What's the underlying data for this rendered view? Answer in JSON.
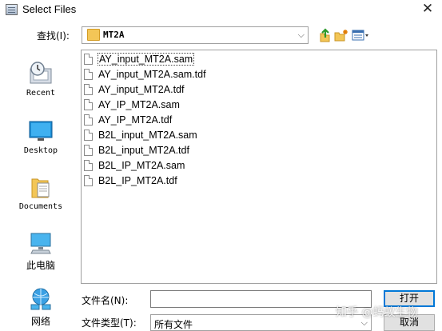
{
  "window": {
    "title": "Select Files",
    "close_glyph": "✕"
  },
  "toolbar": {
    "look_in_label": "查找(I):",
    "look_in_value": "MT2A",
    "dropdown_glyph": "⌵"
  },
  "places": [
    {
      "label": "Recent",
      "icon": "recent-icon"
    },
    {
      "label": "Desktop",
      "icon": "desktop-icon"
    },
    {
      "label": "Documents",
      "icon": "documents-icon"
    },
    {
      "label": "此电脑",
      "icon": "computer-icon"
    },
    {
      "label": "网络",
      "icon": "network-icon"
    }
  ],
  "files": [
    "AY_input_MT2A.sam",
    "AY_input_MT2A.sam.tdf",
    "AY_input_MT2A.tdf",
    "AY_IP_MT2A.sam",
    "AY_IP_MT2A.tdf",
    "B2L_input_MT2A.sam",
    "B2L_input_MT2A.tdf",
    "B2L_IP_MT2A.sam",
    "B2L_IP_MT2A.tdf"
  ],
  "bottom": {
    "filename_label": "文件名(N):",
    "filename_value": "",
    "filetype_label": "文件类型(T):",
    "filetype_value": "所有文件",
    "open_label": "打开",
    "cancel_label": "取消"
  },
  "watermark": "知乎 @蚂蚁生物"
}
